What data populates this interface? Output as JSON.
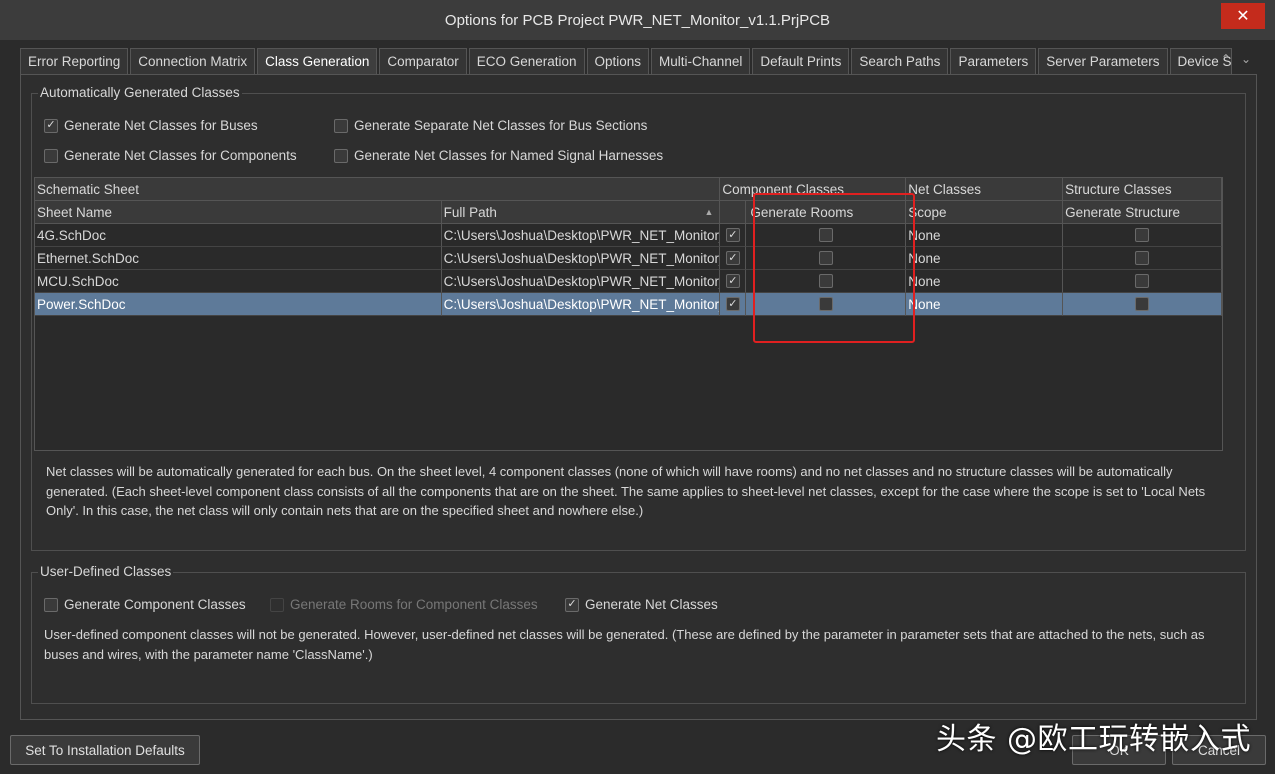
{
  "window": {
    "title": "Options for PCB Project PWR_NET_Monitor_v1.1.PrjPCB",
    "close": "✕"
  },
  "tabs": [
    {
      "label": "Error Reporting"
    },
    {
      "label": "Connection Matrix"
    },
    {
      "label": "Class Generation"
    },
    {
      "label": "Comparator"
    },
    {
      "label": "ECO Generation"
    },
    {
      "label": "Options"
    },
    {
      "label": "Multi-Channel"
    },
    {
      "label": "Default Prints"
    },
    {
      "label": "Search Paths"
    },
    {
      "label": "Parameters"
    },
    {
      "label": "Server Parameters"
    },
    {
      "label": "Device Sheets"
    }
  ],
  "active_tab": "Class Generation",
  "auto": {
    "title": "Automatically Generated Classes",
    "options": [
      {
        "label": "Generate Net Classes for Buses",
        "checked": "✓"
      },
      {
        "label": "Generate Separate Net Classes for Bus Sections",
        "checked": ""
      },
      {
        "label": "Generate Net Classes for Components",
        "checked": ""
      },
      {
        "label": "Generate Net Classes for Named Signal Harnesses",
        "checked": ""
      }
    ],
    "grid": {
      "group_headers": [
        "Schematic Sheet",
        "Component Classes",
        "Net Classes",
        "Structure Classes"
      ],
      "col_headers": [
        "Sheet Name",
        "Full Path",
        "",
        "Generate Rooms",
        "Scope",
        "Generate Structure"
      ],
      "rows": [
        {
          "name": "4G.SchDoc",
          "path": "C:\\Users\\Joshua\\Desktop\\PWR_NET_Monitor_",
          "comp": "✓",
          "rooms": "",
          "scope": "None",
          "structure": ""
        },
        {
          "name": "Ethernet.SchDoc",
          "path": "C:\\Users\\Joshua\\Desktop\\PWR_NET_Monitor_",
          "comp": "✓",
          "rooms": "",
          "scope": "None",
          "structure": ""
        },
        {
          "name": "MCU.SchDoc",
          "path": "C:\\Users\\Joshua\\Desktop\\PWR_NET_Monitor_",
          "comp": "✓",
          "rooms": "",
          "scope": "None",
          "structure": ""
        },
        {
          "name": "Power.SchDoc",
          "path": "C:\\Users\\Joshua\\Desktop\\PWR_NET_Monitor_",
          "comp": "✓",
          "rooms": "",
          "scope": "None",
          "structure": ""
        }
      ],
      "selected_row": "Power.SchDoc"
    },
    "description": "Net classes will be automatically generated for each bus. On the sheet level, 4 component classes (none of which will have rooms) and no net classes and no structure classes will be automatically generated. (Each sheet-level component class consists of all the components that are on the sheet. The same applies to sheet-level net classes, except for the case where the scope is set to 'Local Nets Only'. In this case, the net class will only contain nets that are on the specified sheet and nowhere else.)"
  },
  "user": {
    "title": "User-Defined Classes",
    "options": [
      {
        "label": "Generate Component Classes",
        "checked": ""
      },
      {
        "label": "Generate Rooms for Component Classes",
        "checked": ""
      },
      {
        "label": "Generate Net Classes",
        "checked": "✓"
      }
    ],
    "description": "User-defined component classes will not be generated. However, user-defined net classes will be generated. (These are defined by the parameter in parameter sets that are attached to the nets, such as buses and wires, with the parameter name 'ClassName'.)"
  },
  "buttons": {
    "defaults": "Set To Installation Defaults",
    "ok": "OK",
    "cancel": "Cancel"
  },
  "watermark": "头条 @欧工玩转嵌入式",
  "colors": {
    "selected_row": "#5e7a99",
    "highlight_box": "#e02020",
    "close": "#c42b1c"
  }
}
